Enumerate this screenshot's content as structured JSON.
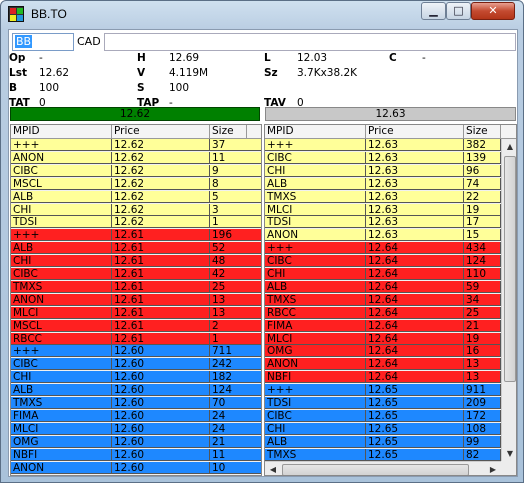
{
  "window": {
    "title": "BB.TO",
    "minimize": "▁",
    "maximize": "□",
    "close": "✕"
  },
  "toolbar": {
    "symbol": "BB",
    "currency": "CAD",
    "extra": ""
  },
  "quote": [
    [
      {
        "l": "Op",
        "v": "-"
      },
      {
        "l": "H",
        "v": "12.69"
      },
      {
        "l": "L",
        "v": "12.03"
      },
      {
        "l": "C",
        "v": "-"
      }
    ],
    [
      {
        "l": "Lst",
        "v": "12.62"
      },
      {
        "l": "V",
        "v": "4.119M"
      },
      {
        "l": "Sz",
        "v": "3.7Kx38.2K"
      },
      {
        "l": "",
        "v": ""
      }
    ],
    [
      {
        "l": "B",
        "v": "100"
      },
      {
        "l": "S",
        "v": "100"
      },
      {
        "l": "",
        "v": ""
      },
      {
        "l": "",
        "v": ""
      }
    ],
    [
      {
        "l": "TAT",
        "v": "0"
      },
      {
        "l": "TAP",
        "v": "-"
      },
      {
        "l": "TAV",
        "v": "0"
      },
      {
        "l": "",
        "v": ""
      }
    ]
  ],
  "bid_price": "12.62",
  "ask_price": "12.63",
  "columns": {
    "mpid": "MPID",
    "price": "Price",
    "size": "Size"
  },
  "colors": {
    "yellow": "#ffff99",
    "red": "#ff2020",
    "blue": "#1e88ff"
  },
  "bids": [
    [
      "+++",
      "12.62",
      "37",
      "yellow"
    ],
    [
      "ANON",
      "12.62",
      "11",
      "yellow"
    ],
    [
      "CIBC",
      "12.62",
      "9",
      "yellow"
    ],
    [
      "MSCL",
      "12.62",
      "8",
      "yellow"
    ],
    [
      "ALB",
      "12.62",
      "5",
      "yellow"
    ],
    [
      "CHI",
      "12.62",
      "3",
      "yellow"
    ],
    [
      "TDSI",
      "12.62",
      "1",
      "yellow"
    ],
    [
      "+++",
      "12.61",
      "196",
      "red"
    ],
    [
      "ALB",
      "12.61",
      "52",
      "red"
    ],
    [
      "CHI",
      "12.61",
      "48",
      "red"
    ],
    [
      "CIBC",
      "12.61",
      "42",
      "red"
    ],
    [
      "TMXS",
      "12.61",
      "25",
      "red"
    ],
    [
      "ANON",
      "12.61",
      "13",
      "red"
    ],
    [
      "MLCI",
      "12.61",
      "13",
      "red"
    ],
    [
      "MSCL",
      "12.61",
      "2",
      "red"
    ],
    [
      "RBCC",
      "12.61",
      "1",
      "red"
    ],
    [
      "+++",
      "12.60",
      "711",
      "blue"
    ],
    [
      "CIBC",
      "12.60",
      "242",
      "blue"
    ],
    [
      "CHI",
      "12.60",
      "182",
      "blue"
    ],
    [
      "ALB",
      "12.60",
      "124",
      "blue"
    ],
    [
      "TMXS",
      "12.60",
      "70",
      "blue"
    ],
    [
      "FIMA",
      "12.60",
      "24",
      "blue"
    ],
    [
      "MLCI",
      "12.60",
      "24",
      "blue"
    ],
    [
      "OMG",
      "12.60",
      "21",
      "blue"
    ],
    [
      "NBFI",
      "12.60",
      "11",
      "blue"
    ],
    [
      "ANON",
      "12.60",
      "10",
      "blue"
    ]
  ],
  "asks": [
    [
      "+++",
      "12.63",
      "382",
      "yellow"
    ],
    [
      "CIBC",
      "12.63",
      "139",
      "yellow"
    ],
    [
      "CHI",
      "12.63",
      "96",
      "yellow"
    ],
    [
      "ALB",
      "12.63",
      "74",
      "yellow"
    ],
    [
      "TMXS",
      "12.63",
      "22",
      "yellow"
    ],
    [
      "MLCI",
      "12.63",
      "19",
      "yellow"
    ],
    [
      "TDSI",
      "12.63",
      "17",
      "yellow"
    ],
    [
      "ANON",
      "12.63",
      "15",
      "yellow"
    ],
    [
      "+++",
      "12.64",
      "434",
      "red"
    ],
    [
      "CIBC",
      "12.64",
      "124",
      "red"
    ],
    [
      "CHI",
      "12.64",
      "110",
      "red"
    ],
    [
      "ALB",
      "12.64",
      "59",
      "red"
    ],
    [
      "TMXS",
      "12.64",
      "34",
      "red"
    ],
    [
      "RBCC",
      "12.64",
      "25",
      "red"
    ],
    [
      "FIMA",
      "12.64",
      "21",
      "red"
    ],
    [
      "MLCI",
      "12.64",
      "19",
      "red"
    ],
    [
      "OMG",
      "12.64",
      "16",
      "red"
    ],
    [
      "ANON",
      "12.64",
      "13",
      "red"
    ],
    [
      "NBFI",
      "12.64",
      "13",
      "red"
    ],
    [
      "+++",
      "12.65",
      "911",
      "blue"
    ],
    [
      "TDSI",
      "12.65",
      "209",
      "blue"
    ],
    [
      "CIBC",
      "12.65",
      "172",
      "blue"
    ],
    [
      "CHI",
      "12.65",
      "108",
      "blue"
    ],
    [
      "ALB",
      "12.65",
      "99",
      "blue"
    ],
    [
      "TMXS",
      "12.65",
      "82",
      "blue"
    ]
  ],
  "scroll": {
    "up": "▲",
    "down": "▼",
    "left": "◀",
    "right": "▶"
  }
}
